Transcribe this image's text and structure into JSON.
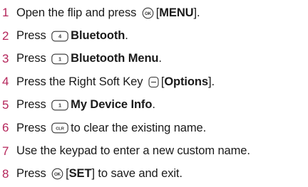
{
  "steps": [
    {
      "number": "1",
      "parts": [
        {
          "t": "text",
          "v": "Open the flip and press "
        },
        {
          "t": "key",
          "icon": "ok-button-icon"
        },
        {
          "t": "text",
          "v": "["
        },
        {
          "t": "bold",
          "v": "MENU"
        },
        {
          "t": "text",
          "v": "]."
        }
      ]
    },
    {
      "number": "2",
      "parts": [
        {
          "t": "text",
          "v": "Press "
        },
        {
          "t": "key",
          "icon": "key-4-icon",
          "label": "4"
        },
        {
          "t": "bold",
          "v": "Bluetooth"
        },
        {
          "t": "text",
          "v": "."
        }
      ]
    },
    {
      "number": "3",
      "parts": [
        {
          "t": "text",
          "v": "Press "
        },
        {
          "t": "key",
          "icon": "key-1-icon",
          "label": "1"
        },
        {
          "t": "bold",
          "v": "Bluetooth Menu"
        },
        {
          "t": "text",
          "v": "."
        }
      ]
    },
    {
      "number": "4",
      "parts": [
        {
          "t": "text",
          "v": "Press the Right Soft Key "
        },
        {
          "t": "key",
          "icon": "right-soft-key-icon"
        },
        {
          "t": "text",
          "v": "["
        },
        {
          "t": "bold",
          "v": "Options"
        },
        {
          "t": "text",
          "v": "]."
        }
      ]
    },
    {
      "number": "5",
      "parts": [
        {
          "t": "text",
          "v": "Press "
        },
        {
          "t": "key",
          "icon": "key-1-icon",
          "label": "1"
        },
        {
          "t": "bold",
          "v": "My Device Info"
        },
        {
          "t": "text",
          "v": "."
        }
      ]
    },
    {
      "number": "6",
      "parts": [
        {
          "t": "text",
          "v": "Press "
        },
        {
          "t": "key",
          "icon": "clear-key-icon",
          "label": "CLR"
        },
        {
          "t": "text",
          "v": "to clear the existing name."
        }
      ]
    },
    {
      "number": "7",
      "parts": [
        {
          "t": "text",
          "v": "Use the keypad to enter a new custom name."
        }
      ]
    },
    {
      "number": "8",
      "parts": [
        {
          "t": "text",
          "v": "Press "
        },
        {
          "t": "key",
          "icon": "ok-button-icon"
        },
        {
          "t": "text",
          "v": "["
        },
        {
          "t": "bold",
          "v": "SET"
        },
        {
          "t": "text",
          "v": "] to save and exit."
        }
      ]
    }
  ],
  "colors": {
    "step_number": "#b5265b",
    "text": "#1a1a1a",
    "key_outline": "#333333"
  }
}
